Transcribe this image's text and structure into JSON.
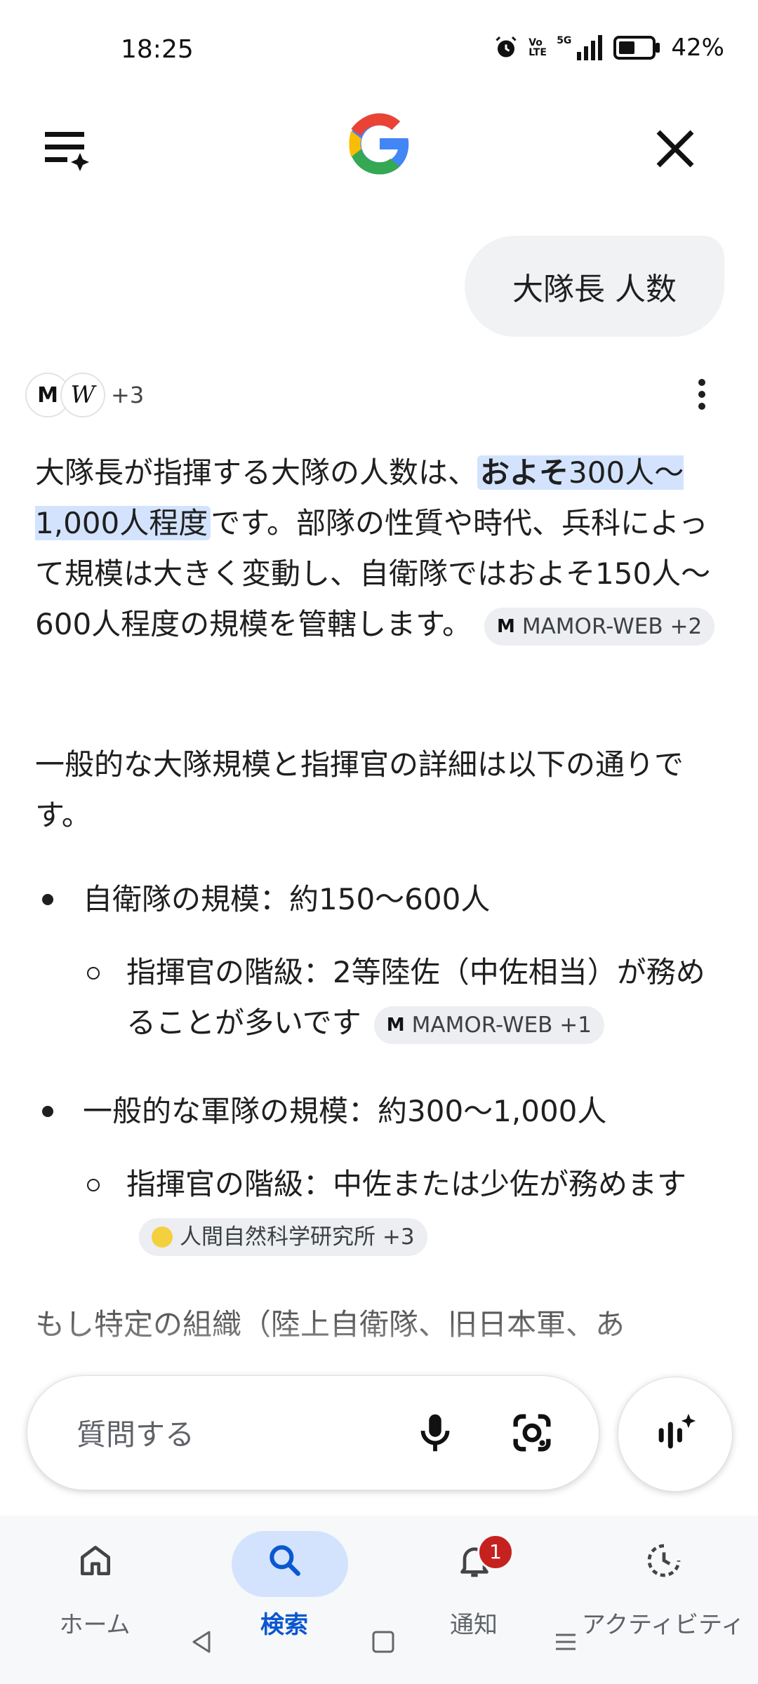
{
  "status_bar": {
    "time": "18:25",
    "battery_percent": "42%",
    "network": "5G",
    "volte": "Vo LTE"
  },
  "app": {
    "logo": "Google"
  },
  "query": {
    "text": "大隊長 人数"
  },
  "sources": {
    "more_count": "+3"
  },
  "answer": {
    "p1_pre": "大隊長が指揮する大隊の人数は、",
    "p1_hl_bold": "およそ",
    "p1_hl_rest": "300人〜1,000人程度",
    "p1_post": "です。部隊の性質や時代、兵科によって規模は大きく変動し、自衛隊ではおよそ150人〜600人程度の規模を管轄します。",
    "p1_chip": "MAMOR-WEB +2",
    "p2": "一般的な大隊規模と指揮官の詳細は以下の通りです。",
    "bullets": [
      {
        "text": "自衛隊の規模：約150〜600人",
        "sub": "指揮官の階級：2等陸佐（中佐相当）が務めることが多いです",
        "chip": "MAMOR-WEB +1"
      },
      {
        "text": "一般的な軍隊の規模：約300〜1,000人",
        "sub": "指揮官の階級：中佐または少佐が務めます",
        "chip": "人間自然科学研究所 +3"
      }
    ],
    "p3": "もし特定の組織（陸上自衛隊、旧日本軍、あ"
  },
  "ask_bar": {
    "placeholder": "質問する"
  },
  "bottom_nav": {
    "items": [
      {
        "label": "ホーム",
        "icon": "home-icon"
      },
      {
        "label": "検索",
        "icon": "search-icon"
      },
      {
        "label": "通知",
        "icon": "bell-icon"
      },
      {
        "label": "アクティビティ",
        "icon": "activity-icon"
      }
    ],
    "notification_count": "1"
  },
  "colors": {
    "accent": "#0b57d0",
    "highlight": "#d3e3fd",
    "badge": "#c5221f"
  }
}
